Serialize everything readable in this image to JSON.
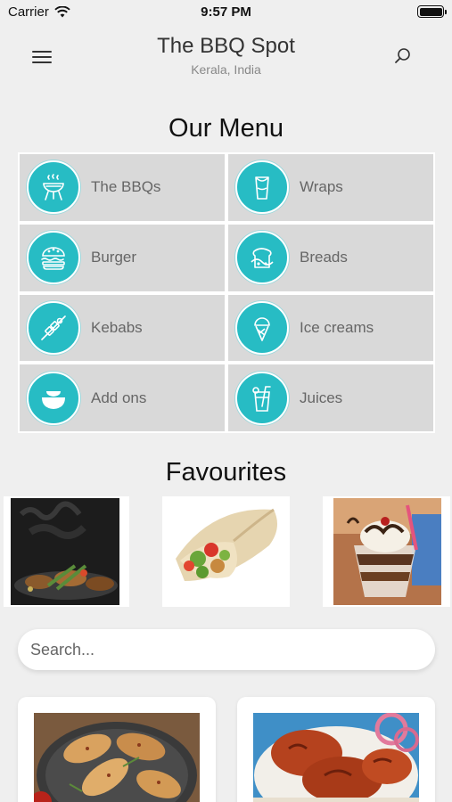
{
  "status_bar": {
    "carrier": "Carrier",
    "time": "9:57 PM"
  },
  "header": {
    "title": "The BBQ Spot",
    "subtitle": "Kerala, India"
  },
  "menu": {
    "title": "Our Menu",
    "items": [
      {
        "label": "The BBQs",
        "icon": "grill-icon"
      },
      {
        "label": "Wraps",
        "icon": "wrap-icon"
      },
      {
        "label": "Burger",
        "icon": "burger-icon"
      },
      {
        "label": "Breads",
        "icon": "bread-icon"
      },
      {
        "label": "Kebabs",
        "icon": "kebab-icon"
      },
      {
        "label": "Ice creams",
        "icon": "ice-cream-icon"
      },
      {
        "label": "Add ons",
        "icon": "bowl-icon"
      },
      {
        "label": "Juices",
        "icon": "juice-icon"
      }
    ]
  },
  "favourites": {
    "title": "Favourites",
    "items": [
      {
        "name": "grilled-chicken-photo"
      },
      {
        "name": "wrap-photo"
      },
      {
        "name": "sundae-photo"
      }
    ]
  },
  "search": {
    "placeholder": "Search..."
  },
  "dishes": [
    {
      "name": "chicken-drumsticks-photo"
    },
    {
      "name": "tandoori-chicken-photo"
    }
  ],
  "colors": {
    "accent": "#27bcc4",
    "background": "#efefef",
    "tile": "#d9d9d9"
  }
}
